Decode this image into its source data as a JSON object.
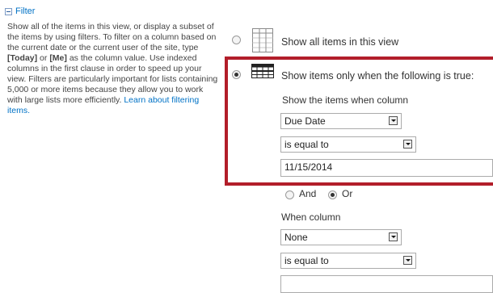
{
  "filter": {
    "header": "Filter",
    "desc_part1": "Show all of the items in this view, or display a subset of the items by using filters. To filter on a column based on the current date or the current user of the site, type ",
    "today_token": "[Today]",
    "or_word": " or ",
    "me_token": "[Me]",
    "desc_part2": " as the column value. Use indexed columns in the first clause in order to speed up your view. Filters are particularly important for lists containing 5,000 or more items because they allow you to work with large lists more efficiently. ",
    "learn_more_link": "Learn about filtering items."
  },
  "options": {
    "show_all_label": "Show all items in this view",
    "show_only_label": "Show items only when the following is true:",
    "show_all_selected": false,
    "show_only_selected": true
  },
  "clause1": {
    "column_label": "Show the items when column",
    "column_value": "Due Date",
    "operator_value": "is equal to",
    "value": "11/15/2014"
  },
  "logic": {
    "and_label": "And",
    "or_label": "Or",
    "selected": "Or"
  },
  "clause2": {
    "column_label": "When column",
    "column_value": "None",
    "operator_value": "is equal to",
    "value": ""
  },
  "colors": {
    "highlight_border": "#b21e2a",
    "link": "#0072c6"
  }
}
